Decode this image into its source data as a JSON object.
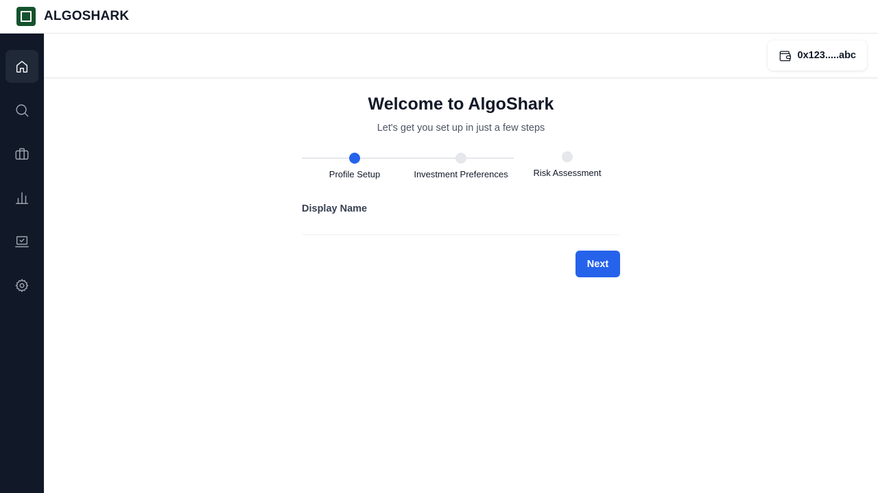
{
  "app": {
    "brand": "ALGOSHARK",
    "brand_color": "#14532d"
  },
  "sidebar": {
    "items": [
      {
        "name": "home",
        "icon": "home-icon",
        "active": true
      },
      {
        "name": "search",
        "icon": "search-icon",
        "active": false
      },
      {
        "name": "portfolio",
        "icon": "briefcase-icon",
        "active": false
      },
      {
        "name": "analytics",
        "icon": "bar-chart-icon",
        "active": false
      },
      {
        "name": "tasks",
        "icon": "laptop-check-icon",
        "active": false
      },
      {
        "name": "settings",
        "icon": "gear-icon",
        "active": false
      }
    ]
  },
  "header": {
    "wallet_address": "0x123.....abc",
    "wallet_icon": "wallet-icon"
  },
  "onboarding": {
    "title": "Welcome to AlgoShark",
    "subtitle": "Let's get you set up in just a few steps",
    "steps": [
      {
        "label": "Profile Setup",
        "active": true
      },
      {
        "label": "Investment Preferences",
        "active": false
      },
      {
        "label": "Risk Assessment",
        "active": false
      }
    ],
    "form": {
      "display_name_label": "Display Name",
      "display_name_value": "",
      "display_name_placeholder": ""
    },
    "next_label": "Next"
  },
  "colors": {
    "accent": "#2563eb",
    "sidebar_bg": "#111827",
    "inactive_step": "#e5e7eb"
  }
}
